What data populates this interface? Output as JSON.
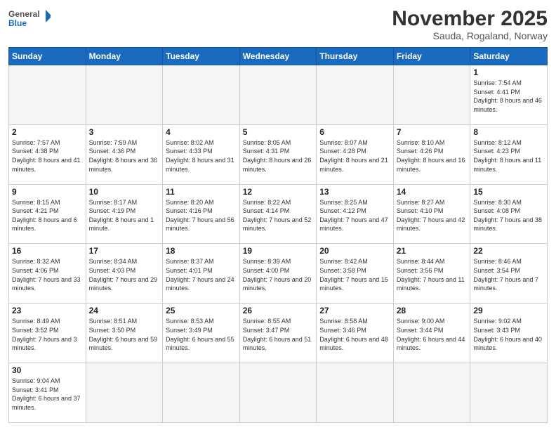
{
  "logo": {
    "text_general": "General",
    "text_blue": "Blue"
  },
  "header": {
    "title": "November 2025",
    "subtitle": "Sauda, Rogaland, Norway"
  },
  "weekdays": [
    "Sunday",
    "Monday",
    "Tuesday",
    "Wednesday",
    "Thursday",
    "Friday",
    "Saturday"
  ],
  "weeks": [
    [
      {
        "day": "",
        "empty": true
      },
      {
        "day": "",
        "empty": true
      },
      {
        "day": "",
        "empty": true
      },
      {
        "day": "",
        "empty": true
      },
      {
        "day": "",
        "empty": true
      },
      {
        "day": "",
        "empty": true
      },
      {
        "day": "1",
        "sunrise": "7:54 AM",
        "sunset": "4:41 PM",
        "daylight": "8 hours and 46 minutes."
      }
    ],
    [
      {
        "day": "2",
        "sunrise": "7:57 AM",
        "sunset": "4:38 PM",
        "daylight": "8 hours and 41 minutes."
      },
      {
        "day": "3",
        "sunrise": "7:59 AM",
        "sunset": "4:36 PM",
        "daylight": "8 hours and 36 minutes."
      },
      {
        "day": "4",
        "sunrise": "8:02 AM",
        "sunset": "4:33 PM",
        "daylight": "8 hours and 31 minutes."
      },
      {
        "day": "5",
        "sunrise": "8:05 AM",
        "sunset": "4:31 PM",
        "daylight": "8 hours and 26 minutes."
      },
      {
        "day": "6",
        "sunrise": "8:07 AM",
        "sunset": "4:28 PM",
        "daylight": "8 hours and 21 minutes."
      },
      {
        "day": "7",
        "sunrise": "8:10 AM",
        "sunset": "4:26 PM",
        "daylight": "8 hours and 16 minutes."
      },
      {
        "day": "8",
        "sunrise": "8:12 AM",
        "sunset": "4:23 PM",
        "daylight": "8 hours and 11 minutes."
      }
    ],
    [
      {
        "day": "9",
        "sunrise": "8:15 AM",
        "sunset": "4:21 PM",
        "daylight": "8 hours and 6 minutes."
      },
      {
        "day": "10",
        "sunrise": "8:17 AM",
        "sunset": "4:19 PM",
        "daylight": "8 hours and 1 minute."
      },
      {
        "day": "11",
        "sunrise": "8:20 AM",
        "sunset": "4:16 PM",
        "daylight": "7 hours and 56 minutes."
      },
      {
        "day": "12",
        "sunrise": "8:22 AM",
        "sunset": "4:14 PM",
        "daylight": "7 hours and 52 minutes."
      },
      {
        "day": "13",
        "sunrise": "8:25 AM",
        "sunset": "4:12 PM",
        "daylight": "7 hours and 47 minutes."
      },
      {
        "day": "14",
        "sunrise": "8:27 AM",
        "sunset": "4:10 PM",
        "daylight": "7 hours and 42 minutes."
      },
      {
        "day": "15",
        "sunrise": "8:30 AM",
        "sunset": "4:08 PM",
        "daylight": "7 hours and 38 minutes."
      }
    ],
    [
      {
        "day": "16",
        "sunrise": "8:32 AM",
        "sunset": "4:06 PM",
        "daylight": "7 hours and 33 minutes."
      },
      {
        "day": "17",
        "sunrise": "8:34 AM",
        "sunset": "4:03 PM",
        "daylight": "7 hours and 29 minutes."
      },
      {
        "day": "18",
        "sunrise": "8:37 AM",
        "sunset": "4:01 PM",
        "daylight": "7 hours and 24 minutes."
      },
      {
        "day": "19",
        "sunrise": "8:39 AM",
        "sunset": "4:00 PM",
        "daylight": "7 hours and 20 minutes."
      },
      {
        "day": "20",
        "sunrise": "8:42 AM",
        "sunset": "3:58 PM",
        "daylight": "7 hours and 15 minutes."
      },
      {
        "day": "21",
        "sunrise": "8:44 AM",
        "sunset": "3:56 PM",
        "daylight": "7 hours and 11 minutes."
      },
      {
        "day": "22",
        "sunrise": "8:46 AM",
        "sunset": "3:54 PM",
        "daylight": "7 hours and 7 minutes."
      }
    ],
    [
      {
        "day": "23",
        "sunrise": "8:49 AM",
        "sunset": "3:52 PM",
        "daylight": "7 hours and 3 minutes."
      },
      {
        "day": "24",
        "sunrise": "8:51 AM",
        "sunset": "3:50 PM",
        "daylight": "6 hours and 59 minutes."
      },
      {
        "day": "25",
        "sunrise": "8:53 AM",
        "sunset": "3:49 PM",
        "daylight": "6 hours and 55 minutes."
      },
      {
        "day": "26",
        "sunrise": "8:55 AM",
        "sunset": "3:47 PM",
        "daylight": "6 hours and 51 minutes."
      },
      {
        "day": "27",
        "sunrise": "8:58 AM",
        "sunset": "3:46 PM",
        "daylight": "6 hours and 48 minutes."
      },
      {
        "day": "28",
        "sunrise": "9:00 AM",
        "sunset": "3:44 PM",
        "daylight": "6 hours and 44 minutes."
      },
      {
        "day": "29",
        "sunrise": "9:02 AM",
        "sunset": "3:43 PM",
        "daylight": "6 hours and 40 minutes."
      }
    ],
    [
      {
        "day": "30",
        "sunrise": "9:04 AM",
        "sunset": "3:41 PM",
        "daylight": "6 hours and 37 minutes."
      },
      {
        "day": "",
        "empty": true
      },
      {
        "day": "",
        "empty": true
      },
      {
        "day": "",
        "empty": true
      },
      {
        "day": "",
        "empty": true
      },
      {
        "day": "",
        "empty": true
      },
      {
        "day": "",
        "empty": true
      }
    ]
  ]
}
